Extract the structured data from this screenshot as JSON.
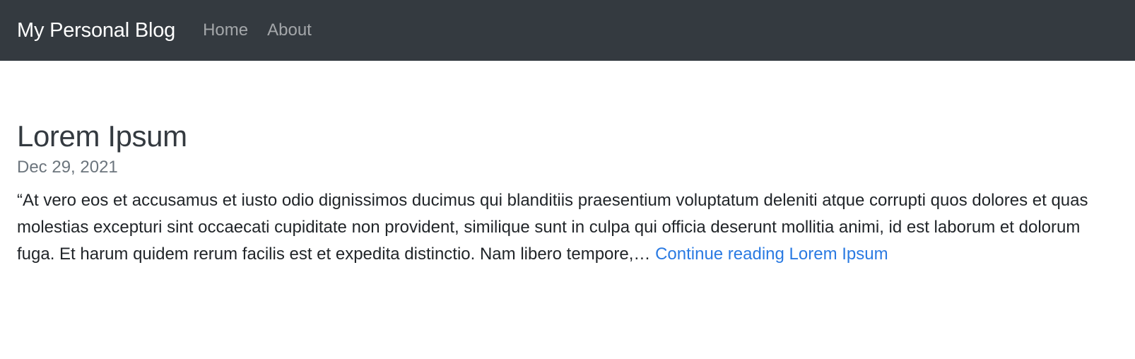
{
  "navbar": {
    "brand": "My Personal Blog",
    "links": [
      {
        "label": "Home"
      },
      {
        "label": "About"
      }
    ]
  },
  "post": {
    "title": "Lorem Ipsum",
    "date": "Dec 29, 2021",
    "excerpt": "“At vero eos et accusamus et iusto odio dignissimos ducimus qui blanditiis praesentium voluptatum deleniti atque corrupti quos dolores et quas molestias excepturi sint occaecati cupiditate non provident, similique sunt in culpa qui officia deserunt mollitia animi, id est laborum et dolorum fuga. Et harum quidem rerum facilis est et expedita distinctio. Nam libero tempore,…",
    "read_more": "Continue reading Lorem Ipsum"
  },
  "colors": {
    "navbar_bg": "#343a40",
    "link": "#2a7ae2",
    "muted": "#6c757d"
  }
}
